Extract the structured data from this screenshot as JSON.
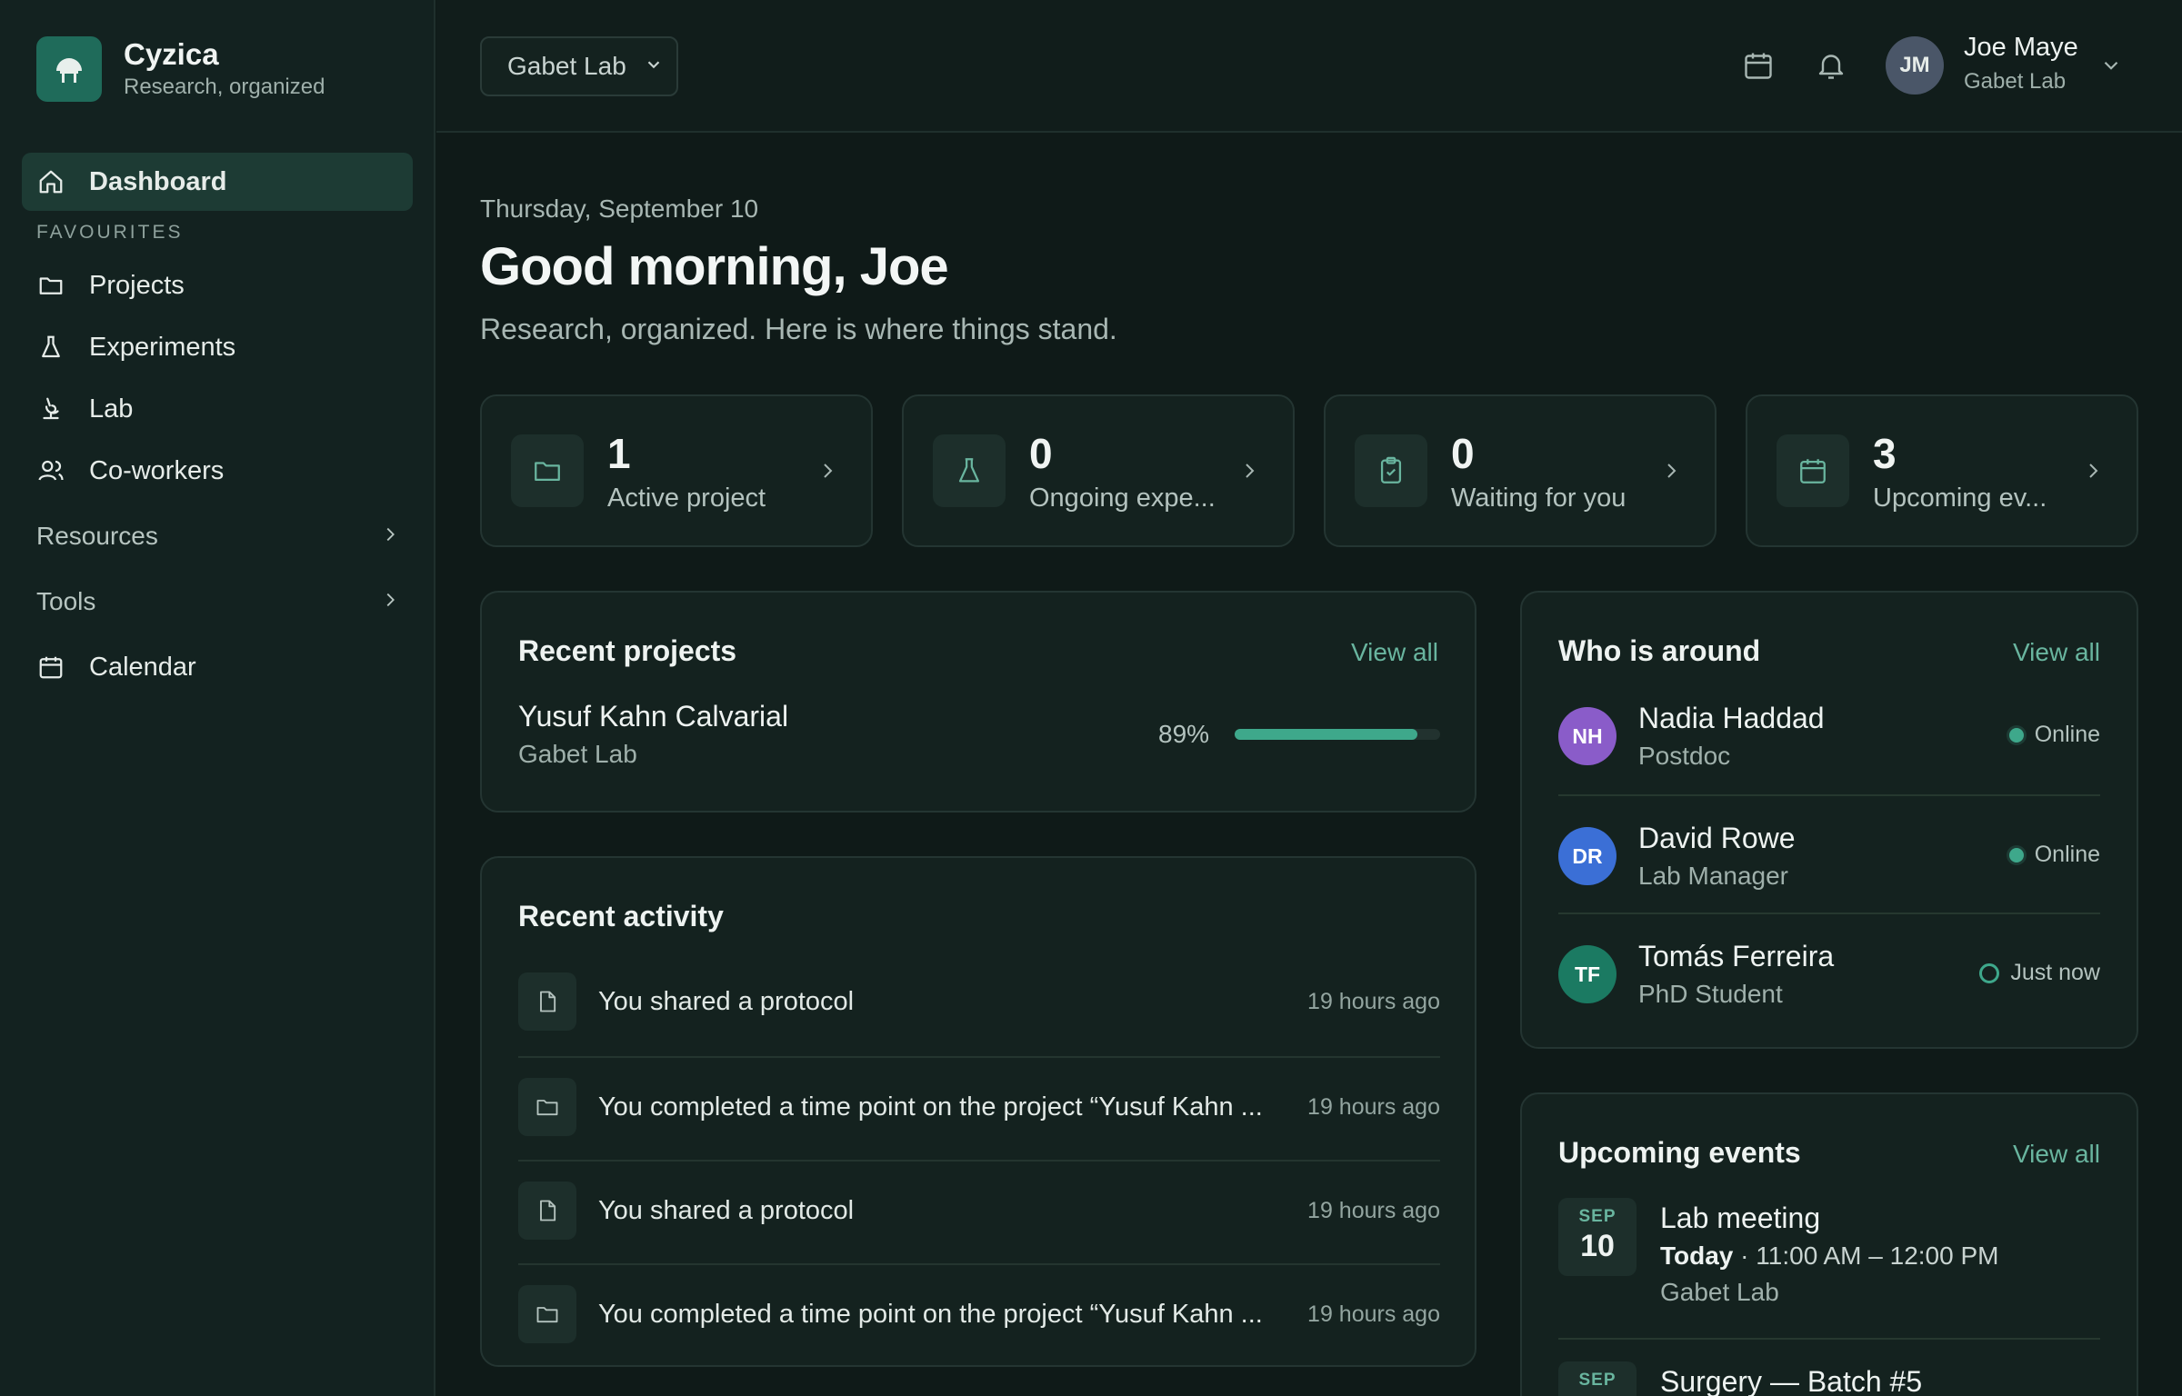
{
  "brand": {
    "name": "Cyzica",
    "tagline": "Research, organized"
  },
  "sidebar": {
    "active": {
      "label": "Dashboard",
      "icon": "home-icon"
    },
    "section_label": "FAVOURITES",
    "items": [
      {
        "label": "Projects",
        "icon": "folder-icon"
      },
      {
        "label": "Experiments",
        "icon": "flask-icon"
      },
      {
        "label": "Lab",
        "icon": "microscope-icon"
      },
      {
        "label": "Co-workers",
        "icon": "users-icon"
      }
    ],
    "groups": [
      {
        "label": "Resources"
      },
      {
        "label": "Tools"
      }
    ],
    "calendar": {
      "label": "Calendar",
      "icon": "calendar-icon"
    }
  },
  "header": {
    "lab_select": "Gabet Lab",
    "user": {
      "initials": "JM",
      "name": "Joe Maye",
      "lab": "Gabet Lab"
    }
  },
  "main": {
    "date": "Thursday, September 10",
    "greeting": "Good morning, Joe",
    "subtitle": "Research, organized. Here is where things stand."
  },
  "stats": [
    {
      "value": "1",
      "label": "Active project",
      "icon": "folder-icon"
    },
    {
      "value": "0",
      "label": "Ongoing expe...",
      "icon": "flask-icon"
    },
    {
      "value": "0",
      "label": "Waiting for you",
      "icon": "clipboard-check-icon"
    },
    {
      "value": "3",
      "label": "Upcoming ev...",
      "icon": "calendar-icon"
    }
  ],
  "recent_projects": {
    "title": "Recent projects",
    "view_all": "View all",
    "items": [
      {
        "name": "Yusuf Kahn Calvarial",
        "lab": "Gabet Lab",
        "progress_label": "89%",
        "progress": 0.89
      }
    ]
  },
  "recent_activity": {
    "title": "Recent activity",
    "items": [
      {
        "text": "You shared a protocol",
        "time": "19 hours ago",
        "icon": "file-icon"
      },
      {
        "text": "You completed a time point on the project “Yusuf Kahn ...",
        "time": "19 hours ago",
        "icon": "folder-icon"
      },
      {
        "text": "You shared a protocol",
        "time": "19 hours ago",
        "icon": "file-icon"
      },
      {
        "text": "You completed a time point on the project “Yusuf Kahn ...",
        "time": "19 hours ago",
        "icon": "folder-icon"
      }
    ]
  },
  "who_is_around": {
    "title": "Who is around",
    "view_all": "View all",
    "people": [
      {
        "initials": "NH",
        "name": "Nadia Haddad",
        "role": "Postdoc",
        "status": "Online",
        "avatar_color": "#8a5cc9",
        "status_color": "#3ea88b"
      },
      {
        "initials": "DR",
        "name": "David Rowe",
        "role": "Lab Manager",
        "status": "Online",
        "avatar_color": "#3b6fd6",
        "status_color": "#3ea88b"
      },
      {
        "initials": "TF",
        "name": "Tomás Ferreira",
        "role": "PhD Student",
        "status": "Just now",
        "avatar_color": "#1b7a62",
        "status_color": "#3ea88b"
      }
    ]
  },
  "upcoming_events": {
    "title": "Upcoming events",
    "view_all": "View all",
    "events": [
      {
        "month": "SEP",
        "day": "10",
        "title": "Lab meeting",
        "when_bold": "Today",
        "when_rest": " · 11:00 AM – 12:00 PM",
        "lab": "Gabet Lab"
      },
      {
        "month": "SEP",
        "title": "Surgery — Batch #5"
      }
    ]
  },
  "colors": {
    "accent": "#3ea88b",
    "link": "#69b59f",
    "background": "#0f1a18"
  }
}
